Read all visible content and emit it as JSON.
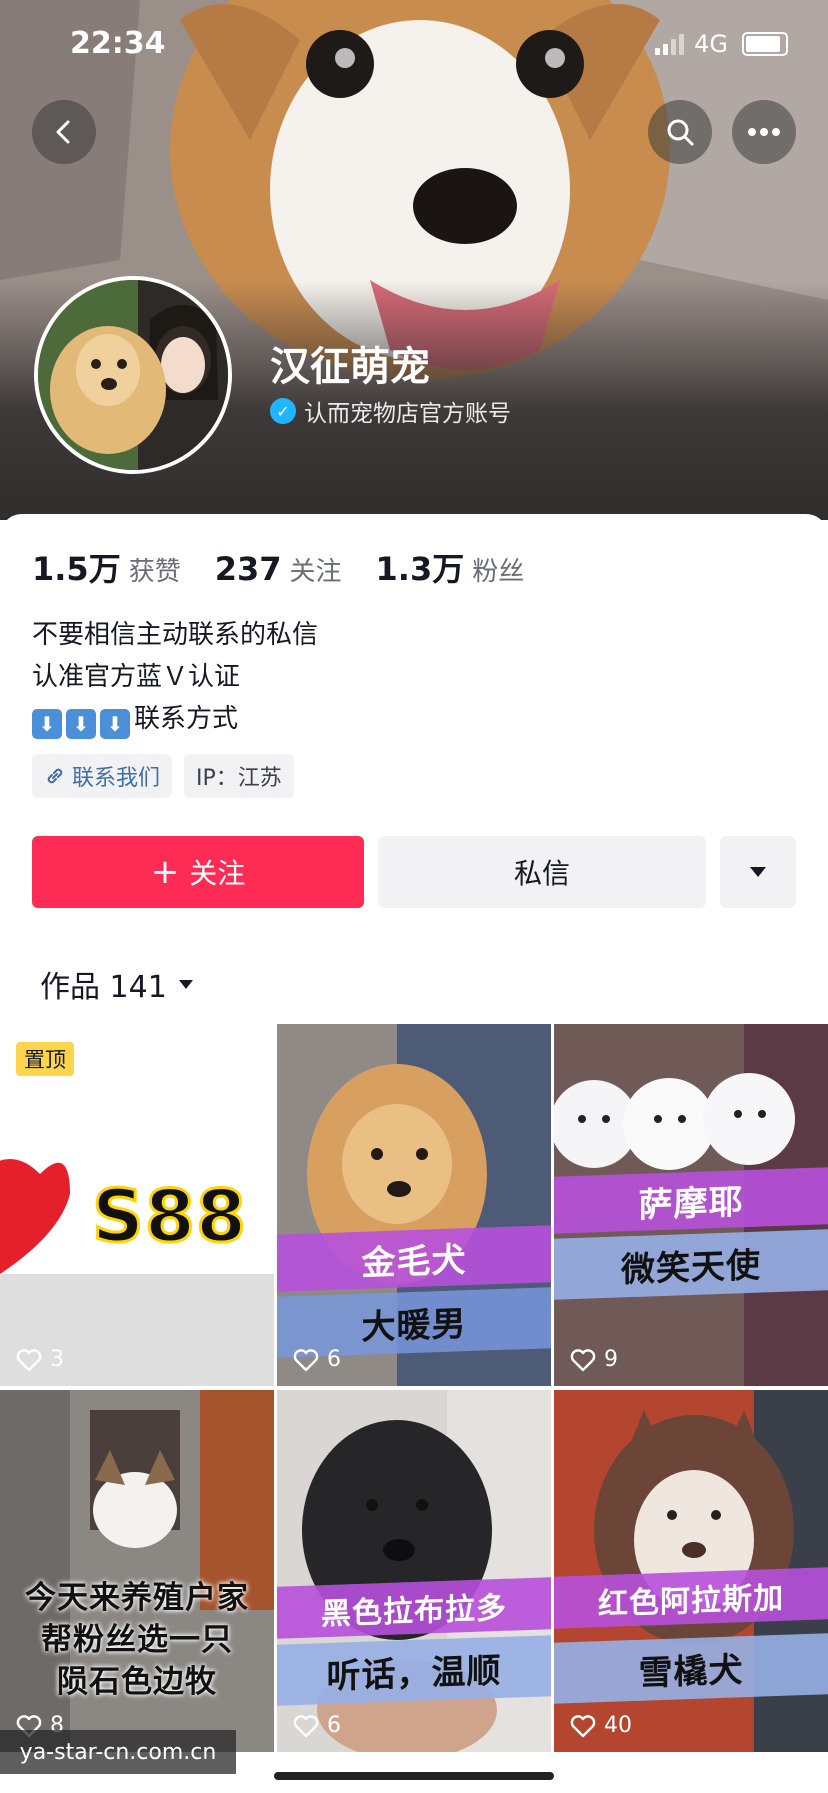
{
  "status": {
    "time": "22:34",
    "network": "4G"
  },
  "profile": {
    "name": "汉征萌宠",
    "verified_text": "认而宠物店官方账号",
    "stats": [
      {
        "value": "1.5万",
        "label": "获赞"
      },
      {
        "value": "237",
        "label": "关注"
      },
      {
        "value": "1.3万",
        "label": "粉丝"
      }
    ],
    "bio": [
      "不要相信主动联系的私信",
      "认准官方蓝Ｖ认证",
      "联系方式"
    ],
    "bio_arrows": [
      "⬇",
      "⬇",
      "⬇"
    ],
    "tags": {
      "contact": "联系我们",
      "ip": "IP：江苏"
    }
  },
  "actions": {
    "follow": "关注",
    "follow_prefix": "+",
    "message": "私信"
  },
  "works": {
    "label": "作品 141"
  },
  "videos": [
    {
      "pinned": "置顶",
      "caption1": "S88",
      "caption2": "",
      "likes": "3"
    },
    {
      "caption1": "金毛犬",
      "caption2": "大暖男",
      "likes": "6"
    },
    {
      "caption1": "萨摩耶",
      "caption2": "微笑天使",
      "likes": "9"
    },
    {
      "caption1": "今天来养殖户家",
      "caption2": "帮粉丝选一只",
      "caption3": "陨石色边牧",
      "likes": "8"
    },
    {
      "caption1": "黑色拉布拉多",
      "caption2": "听话，温顺",
      "likes": "6"
    },
    {
      "caption1": "红色阿拉斯加",
      "caption2": "雪橇犬",
      "likes": "40"
    }
  ],
  "watermark": "ya-star-cn.com.cn",
  "colors": {
    "accent": "#fe2c55",
    "verified": "#20b6ff",
    "pin": "#fcd54d"
  }
}
